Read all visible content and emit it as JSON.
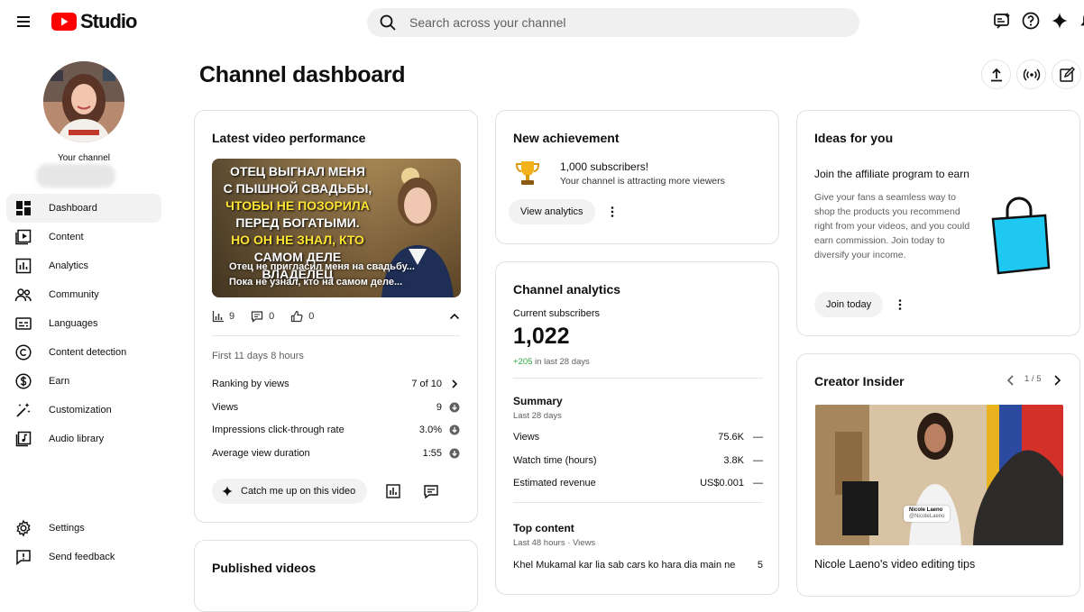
{
  "app": {
    "logo_text": "Studio"
  },
  "search": {
    "placeholder": "Search across your channel"
  },
  "page": {
    "title": "Channel dashboard"
  },
  "channel": {
    "label": "Your channel"
  },
  "sidebar": {
    "items": [
      {
        "label": "Dashboard",
        "icon": "dashboard-icon",
        "active": true
      },
      {
        "label": "Content",
        "icon": "content-icon"
      },
      {
        "label": "Analytics",
        "icon": "analytics-icon"
      },
      {
        "label": "Community",
        "icon": "community-icon"
      },
      {
        "label": "Languages",
        "icon": "languages-icon"
      },
      {
        "label": "Content detection",
        "icon": "copyright-icon"
      },
      {
        "label": "Earn",
        "icon": "dollar-icon"
      },
      {
        "label": "Customization",
        "icon": "wand-icon"
      },
      {
        "label": "Audio library",
        "icon": "audio-library-icon"
      }
    ],
    "bottom": [
      {
        "label": "Settings",
        "icon": "gear-icon"
      },
      {
        "label": "Send feedback",
        "icon": "feedback-icon"
      }
    ]
  },
  "latest": {
    "title": "Latest video performance",
    "thumb_overlay_lines": [
      "ОТЕЦ ВЫГНАЛ МЕНЯ",
      "С ПЫШНОЙ СВАДЬБЫ,",
      "ЧТОБЫ НЕ ПОЗОРИЛА",
      "ПЕРЕД БОГАТЫМИ.",
      "НО ОН НЕ ЗНАЛ, КТО",
      "САМОМ ДЕЛЕ ВЛАДЕЛЕЦ"
    ],
    "video_title_1": "Отец не пригласил меня на свадьбу...",
    "video_title_2": "Пока не узнал, кто на самом деле...",
    "views_count": "9",
    "comments_count": "0",
    "likes_count": "0",
    "period": "First 11 days 8 hours",
    "rows": [
      {
        "label": "Ranking by views",
        "value": "7 of 10"
      },
      {
        "label": "Views",
        "value": "9"
      },
      {
        "label": "Impressions click-through rate",
        "value": "3.0%"
      },
      {
        "label": "Average view duration",
        "value": "1:55"
      }
    ],
    "catch_up": "Catch me up on this video"
  },
  "published": {
    "title": "Published videos"
  },
  "achievement": {
    "title": "New achievement",
    "headline": "1,000 subscribers!",
    "sub": "Your channel is attracting more viewers",
    "button": "View analytics"
  },
  "analytics": {
    "title": "Channel analytics",
    "subs_label": "Current subscribers",
    "subs_value": "1,022",
    "subs_delta": "+205",
    "subs_delta_period": "in last 28 days",
    "summary_title": "Summary",
    "summary_period": "Last 28 days",
    "summary": [
      {
        "label": "Views",
        "value": "75.6K"
      },
      {
        "label": "Watch time (hours)",
        "value": "3.8K"
      },
      {
        "label": "Estimated revenue",
        "value": "US$0.001"
      }
    ],
    "top_title": "Top content",
    "top_period": "Last 48 hours · Views",
    "top_item": "Khel Mukamal kar lia sab cars ko hara dia main ne",
    "top_value": "5"
  },
  "ideas": {
    "title": "Ideas for you",
    "headline": "Join the affiliate program to earn",
    "body": "Give your fans a seamless way to shop the products you recommend right from your videos, and you could earn commission. Join today to diversify your income.",
    "button": "Join today"
  },
  "insider": {
    "title": "Creator Insider",
    "pager": "1 / 5",
    "tag_name": "Nicole Laeno",
    "tag_handle": "@NicoleLaeno",
    "video_title": "Nicole Laeno's video editing tips"
  },
  "colors": {
    "brand_red": "#ff0000",
    "positive_green": "#2ba640",
    "bag_cyan": "#1fc8f0"
  }
}
